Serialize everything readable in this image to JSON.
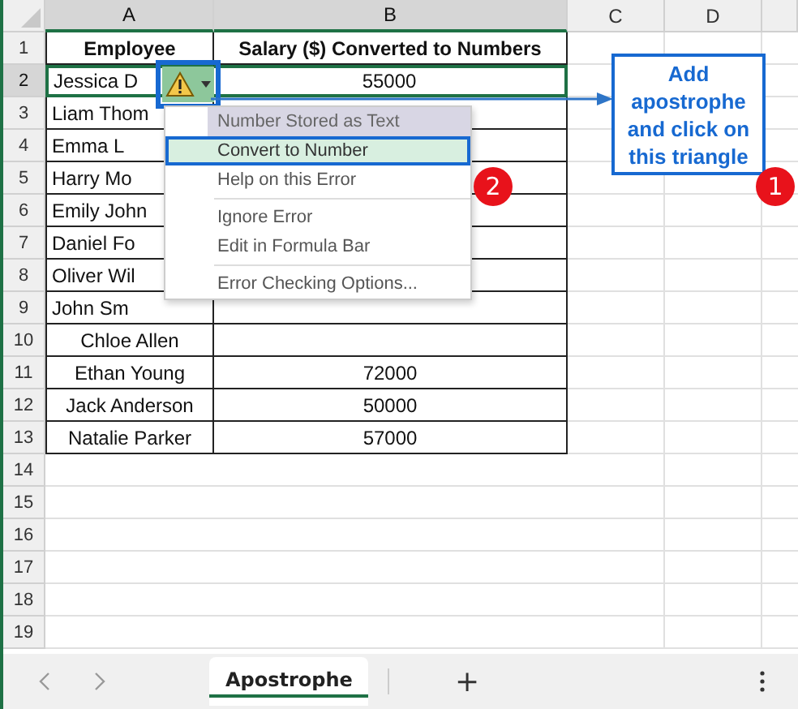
{
  "columns": [
    {
      "label": "A",
      "selected": true
    },
    {
      "label": "B",
      "selected": true
    },
    {
      "label": "C",
      "selected": false
    },
    {
      "label": "D",
      "selected": false
    }
  ],
  "rows": [
    {
      "number": "1",
      "selected": false,
      "kind": "header",
      "cells": [
        "Employee",
        "Salary ($) Converted to Numbers"
      ]
    },
    {
      "number": "2",
      "selected": true,
      "kind": "data",
      "covered": true,
      "cells": [
        "Jessica D",
        "55000"
      ]
    },
    {
      "number": "3",
      "selected": false,
      "kind": "data",
      "covered": true,
      "cells": [
        "Liam Thom"
      ]
    },
    {
      "number": "4",
      "selected": false,
      "kind": "data",
      "covered": true,
      "cells": [
        "Emma L"
      ]
    },
    {
      "number": "5",
      "selected": false,
      "kind": "data",
      "covered": true,
      "cells": [
        "Harry Mo"
      ]
    },
    {
      "number": "6",
      "selected": false,
      "kind": "data",
      "covered": true,
      "cells": [
        "Emily John"
      ]
    },
    {
      "number": "7",
      "selected": false,
      "kind": "data",
      "covered": true,
      "cells": [
        "Daniel Fo"
      ]
    },
    {
      "number": "8",
      "selected": false,
      "kind": "data",
      "covered": true,
      "cells": [
        "Oliver Wil"
      ]
    },
    {
      "number": "9",
      "selected": false,
      "kind": "data",
      "covered": true,
      "cells": [
        "John Sm"
      ]
    },
    {
      "number": "10",
      "selected": false,
      "kind": "data",
      "covered": false,
      "cells": [
        "Chloe Allen"
      ]
    },
    {
      "number": "11",
      "selected": false,
      "kind": "data",
      "covered": false,
      "cells": [
        "Ethan Young",
        "72000"
      ]
    },
    {
      "number": "12",
      "selected": false,
      "kind": "data",
      "covered": false,
      "cells": [
        "Jack Anderson",
        "50000"
      ]
    },
    {
      "number": "13",
      "selected": false,
      "kind": "data",
      "covered": false,
      "cells": [
        "Natalie Parker",
        "57000"
      ]
    },
    {
      "number": "14",
      "selected": false,
      "kind": "empty",
      "cells": []
    },
    {
      "number": "15",
      "selected": false,
      "kind": "empty",
      "cells": []
    },
    {
      "number": "16",
      "selected": false,
      "kind": "empty",
      "cells": []
    },
    {
      "number": "17",
      "selected": false,
      "kind": "empty",
      "cells": []
    },
    {
      "number": "18",
      "selected": false,
      "kind": "empty",
      "cells": []
    },
    {
      "number": "19",
      "selected": false,
      "kind": "empty",
      "cells": []
    }
  ],
  "error_menu": {
    "items": [
      {
        "kind": "header",
        "label": "Number Stored as Text"
      },
      {
        "kind": "item",
        "label": "Convert to Number",
        "selected": true
      },
      {
        "kind": "item",
        "label": "Help on this Error",
        "selected": false
      },
      {
        "kind": "separator"
      },
      {
        "kind": "item",
        "label": "Ignore Error",
        "selected": false
      },
      {
        "kind": "item",
        "label": "Edit in Formula Bar",
        "selected": false
      },
      {
        "kind": "separator"
      },
      {
        "kind": "item",
        "label": "Error Checking Options...",
        "selected": false
      }
    ]
  },
  "callout": {
    "text": "Add apostrophe and click on this triangle"
  },
  "badges": [
    "2",
    "1"
  ],
  "sheet_tabs": [
    {
      "label": "Apostrophe",
      "selected": true
    }
  ],
  "add_sheet": "+"
}
